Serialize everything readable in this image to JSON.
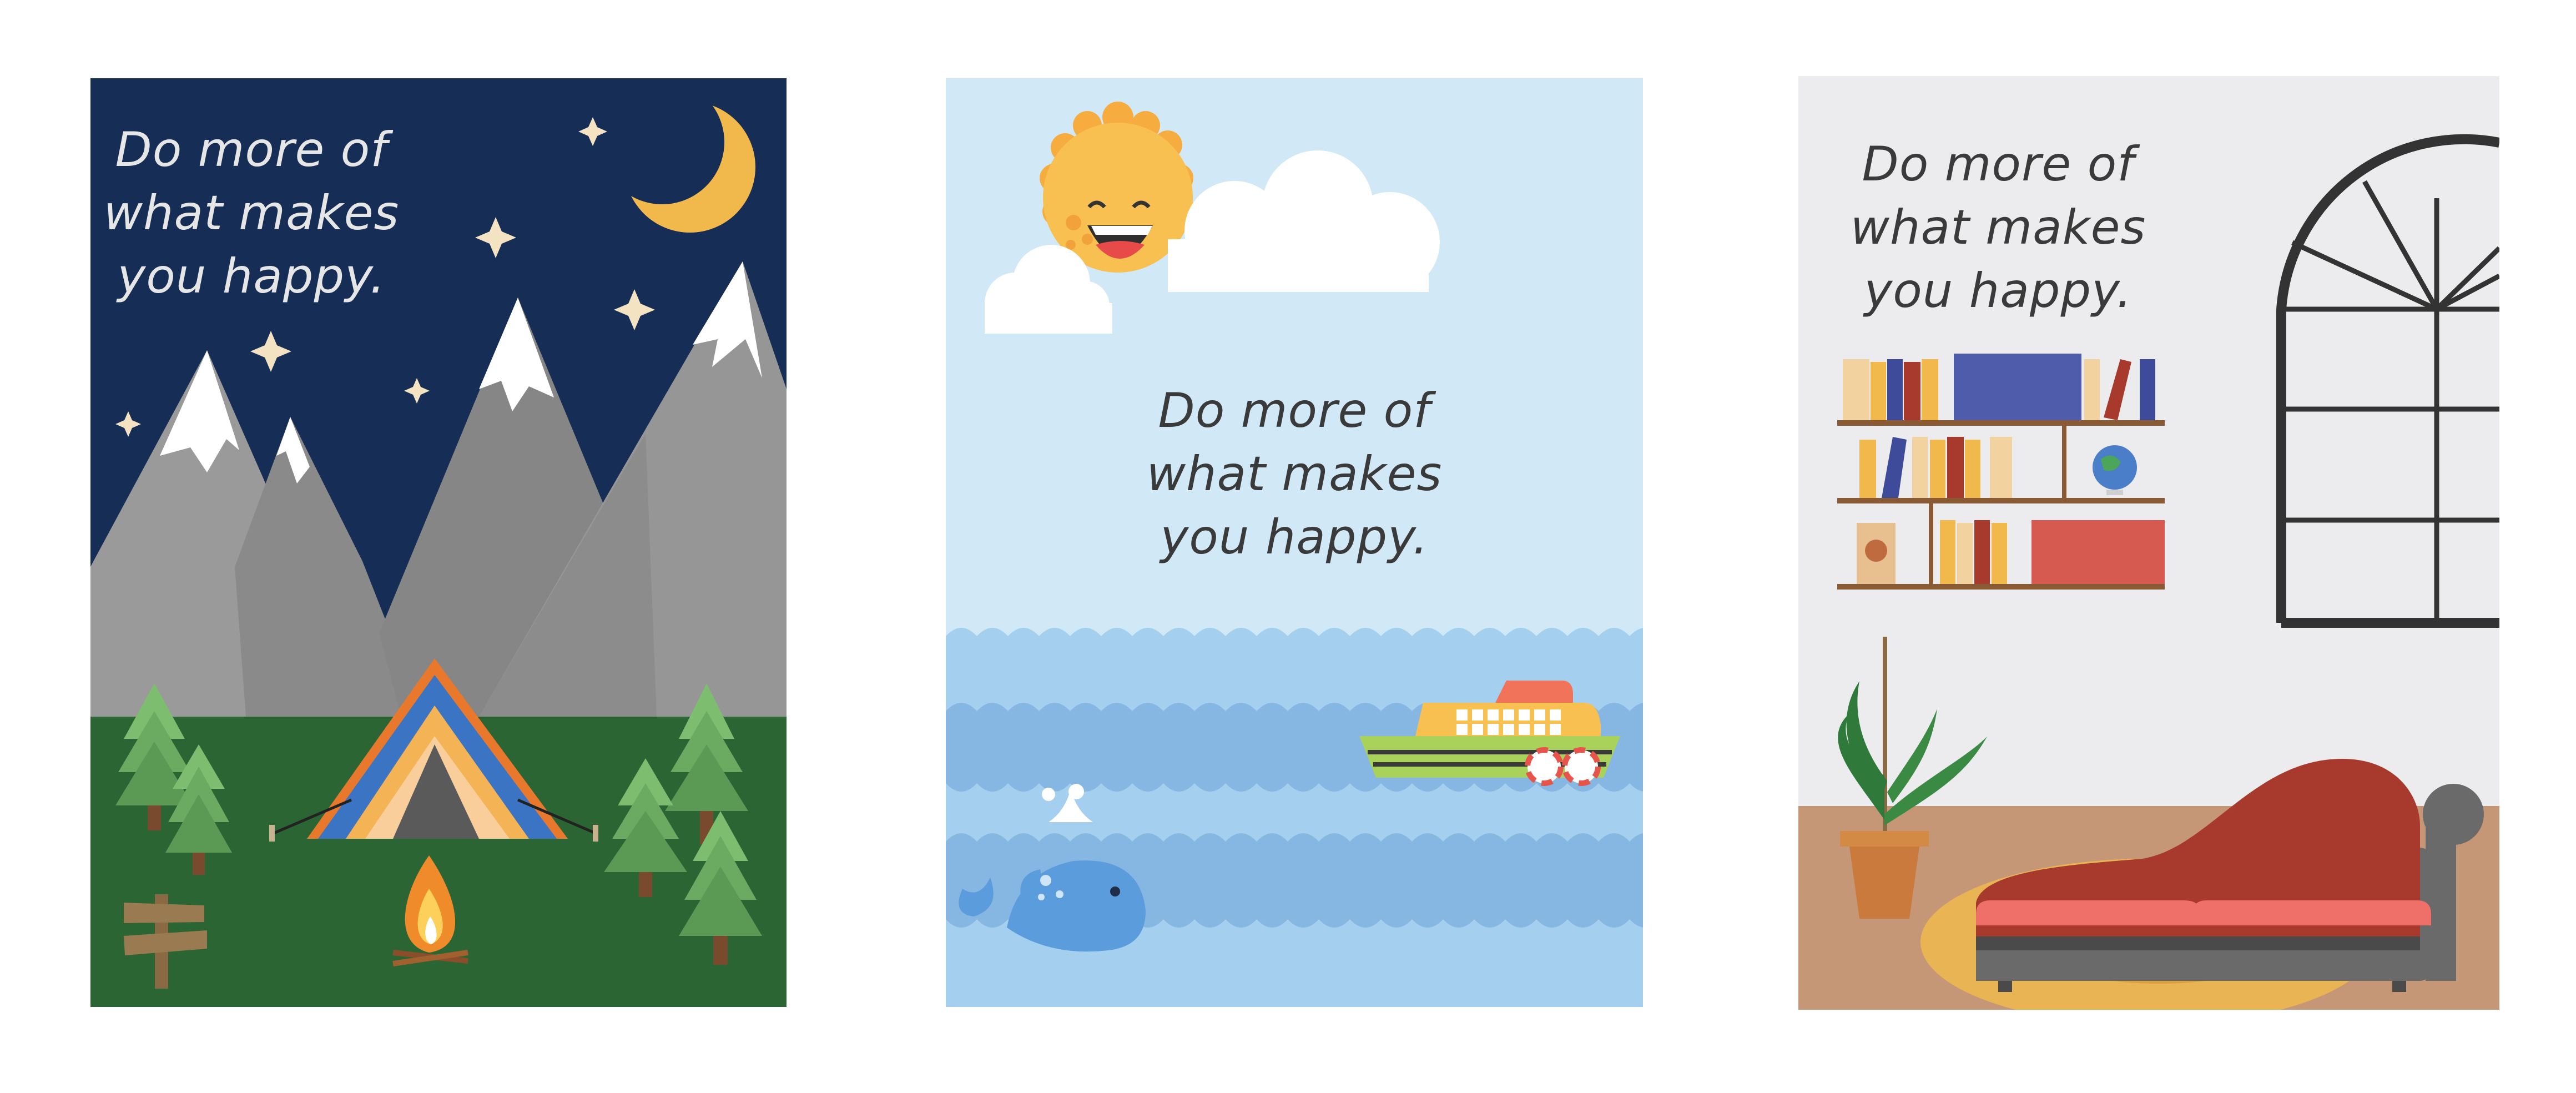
{
  "cards": [
    {
      "scene": "camping",
      "quote": "Do more of\nwhat makes\nyou happy.",
      "colors": {
        "sky": "#162d55",
        "mountain": "#959595",
        "snow": "#ffffff",
        "grass": "#2b6534",
        "moon": "#f1b84c",
        "text": "#e6e6e6"
      }
    },
    {
      "scene": "sea",
      "quote": "Do more of\nwhat makes\nyou happy.",
      "colors": {
        "sky": "#d1e8f7",
        "sea_light": "#a5cfef",
        "sea_dark": "#86b6e2",
        "sun": "#f8c050",
        "whale": "#5a9cdc",
        "text": "#3a3a3a"
      }
    },
    {
      "scene": "living-room",
      "quote": "Do more of\nwhat makes\nyou happy.",
      "colors": {
        "wall": "#ececee",
        "floor": "#c69776",
        "rug": "#e9b453",
        "sofa": "#a8392d",
        "window_frame": "#333333",
        "text": "#3a3a3a"
      }
    }
  ]
}
